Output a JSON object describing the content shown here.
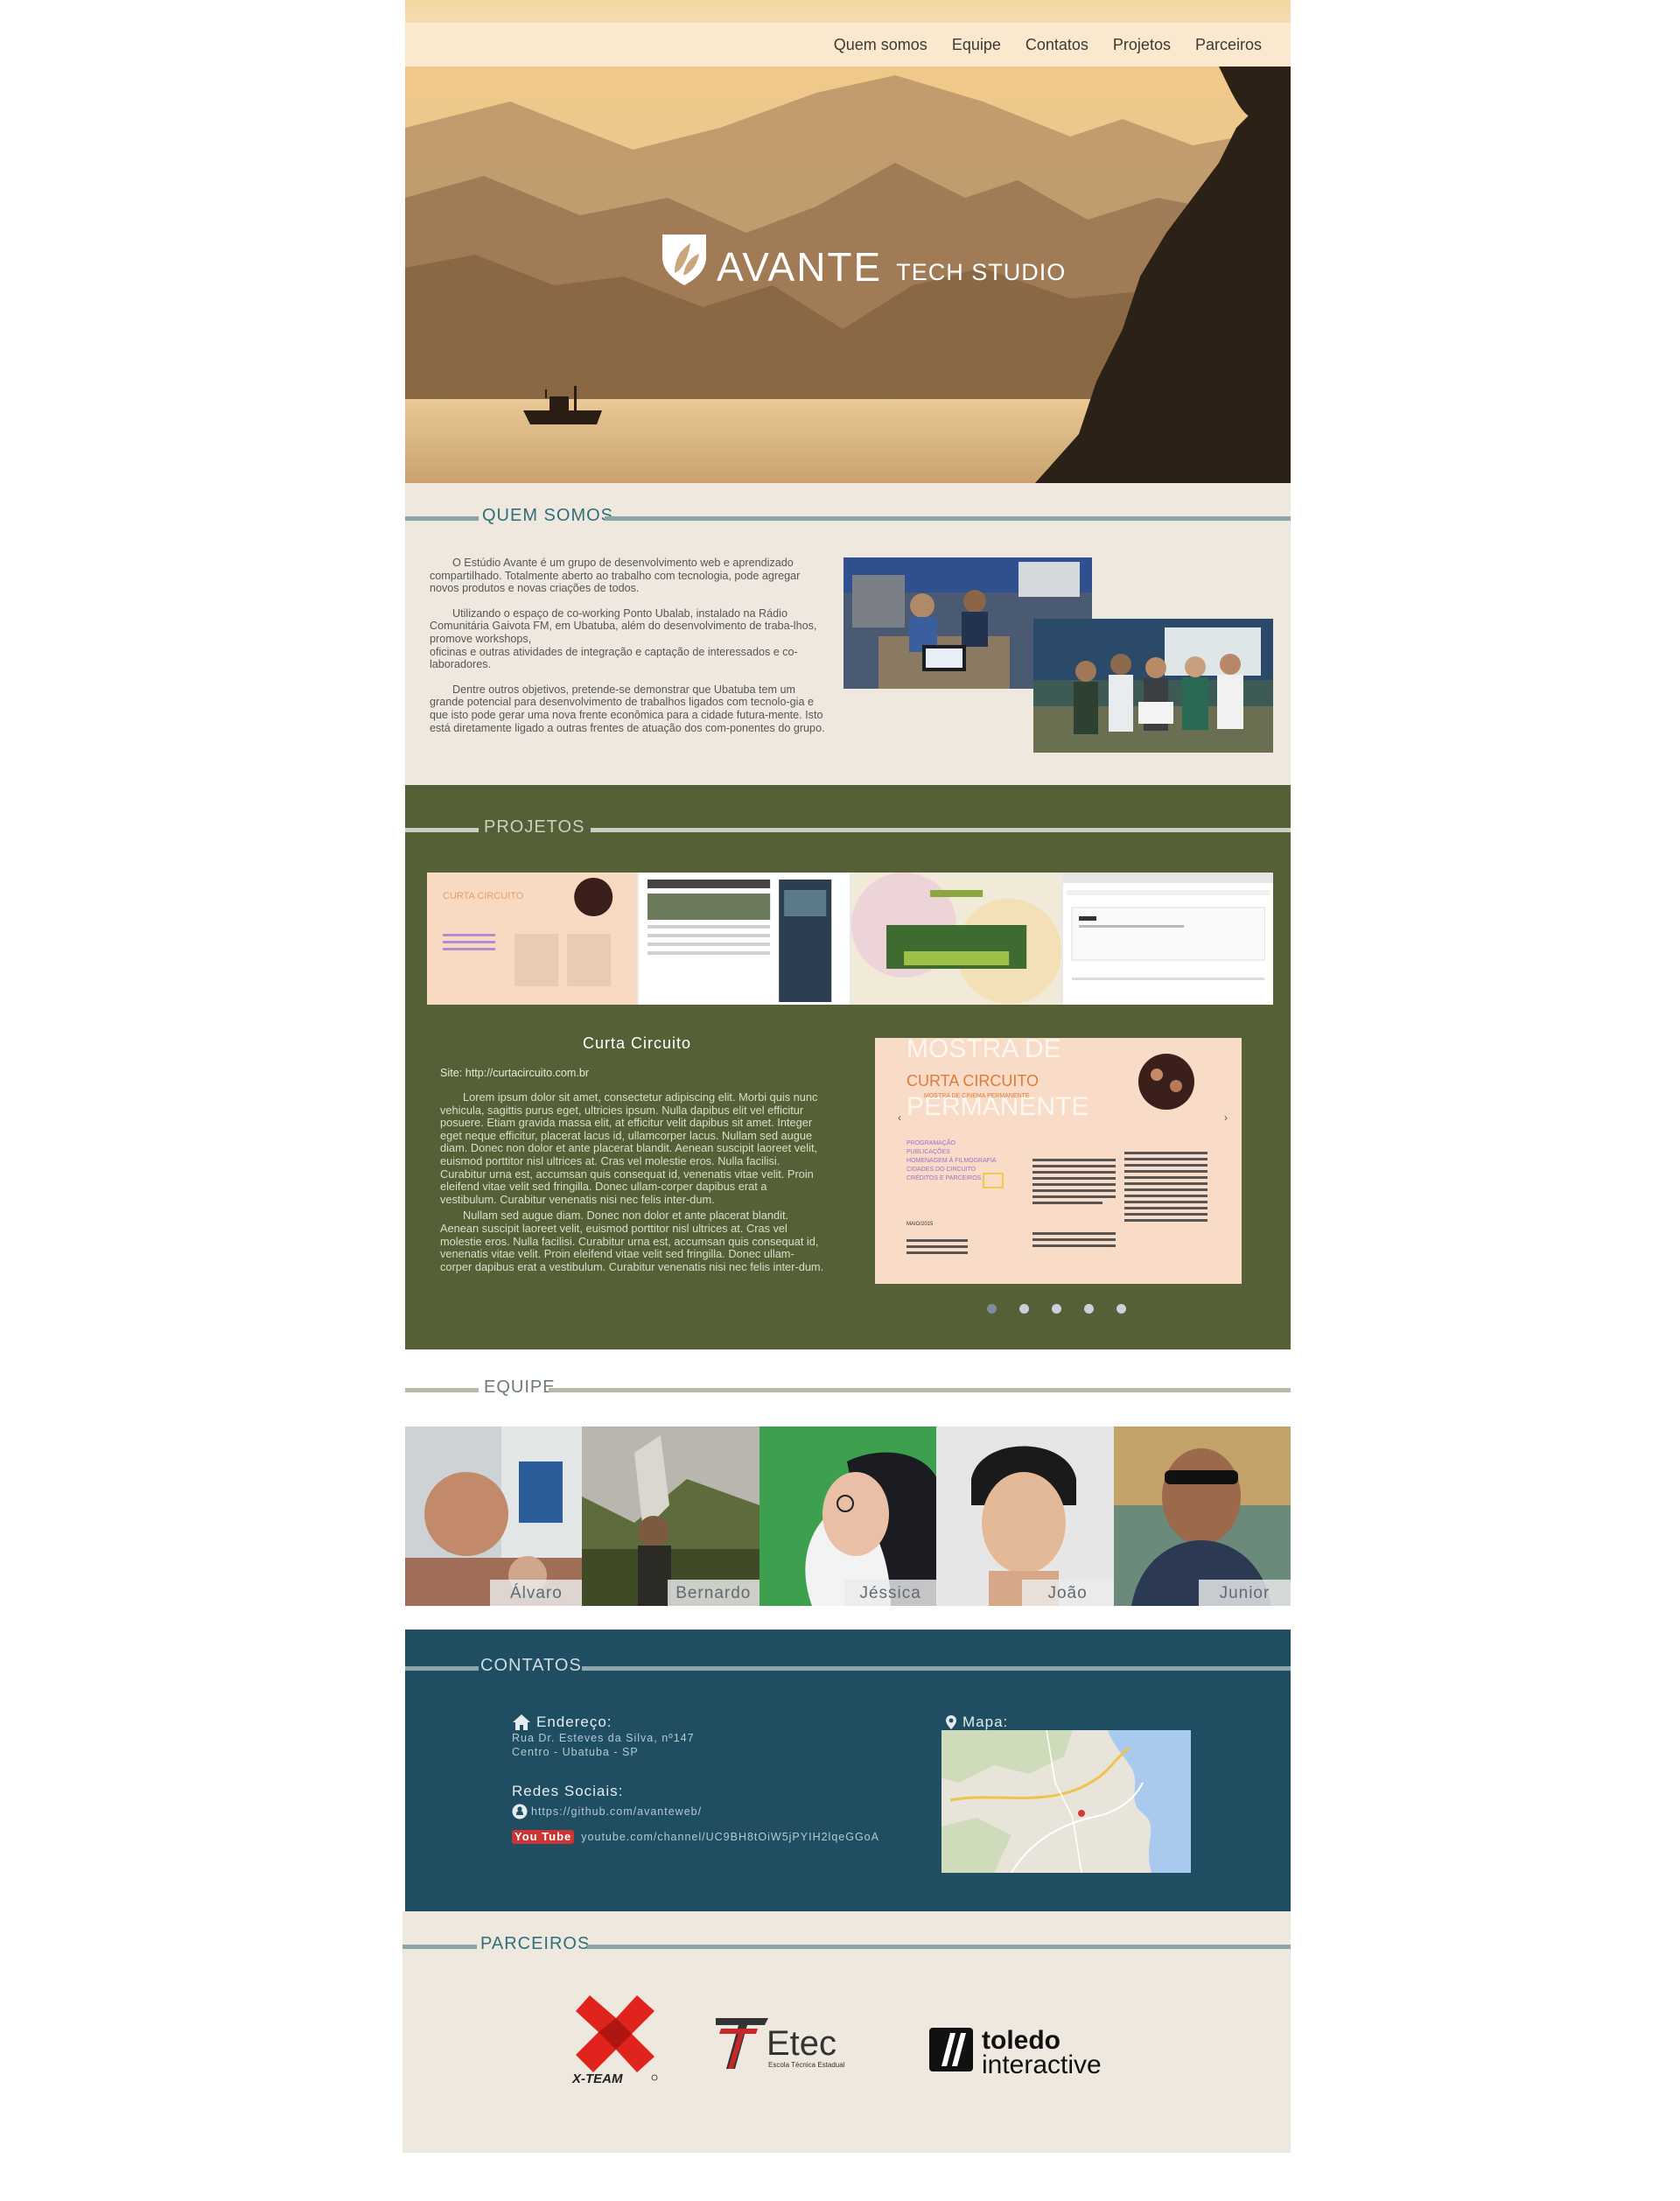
{
  "nav": {
    "items": [
      "Quem somos",
      "Equipe",
      "Contatos",
      "Projetos",
      "Parceiros"
    ]
  },
  "brand": {
    "name": "AVANTE",
    "tagline": "TECH STUDIO"
  },
  "sections": {
    "quem_somos": "QUEM SOMOS",
    "projetos": "PROJETOS",
    "equipe": "EQUIPE",
    "contatos": "CONTATOS",
    "parceiros": "PARCEIROS"
  },
  "about": {
    "paragraphs": [
      "O Estúdio Avante é um grupo de desenvolvimento web e aprendizado compartilhado. Totalmente aberto ao trabalho com tecnologia, pode agregar novos produtos e novas criações de todos.",
      "Utilizando o espaço de co-working Ponto Ubalab, instalado na Rádio Comunitária Gaivota FM, em Ubatuba, além do desenvolvimento de traba-lhos, promove workshops,\noficinas e outras atividades de integração e captação de interessados e co-laboradores.",
      "Dentre outros objetivos, pretende-se demonstrar que Ubatuba tem um grande potencial para desenvolvimento de trabalhos ligados com tecnolo-gia e que isto pode gerar uma nova frente econômica para a cidade futura-mente. Isto está diretamente ligado a outras frentes de atuação dos com-ponentes do grupo."
    ]
  },
  "project": {
    "title": "Curta Circuito",
    "site_label": "Site:",
    "site_url": "http://curtacircuito.com.br",
    "paragraphs": [
      "Lorem ipsum dolor sit amet, consectetur adipiscing elit. Morbi quis nunc vehicula, sagittis purus eget, ultricies ipsum. Nulla dapibus elit vel efficitur posuere. Etiam gravida massa elit, at efficitur velit dapibus sit amet. Integer eget neque efficitur, placerat lacus id, ullamcorper lacus. Nullam sed augue diam. Donec non dolor et ante placerat blandit. Aenean suscipit laoreet velit, euismod porttitor nisl ultrices at. Cras vel molestie eros. Nulla facilisi. Curabitur urna est, accumsan quis consequat id, venenatis vitae velit. Proin eleifend vitae velit sed fringilla. Donec ullam-corper dapibus erat a vestibulum. Curabitur venenatis nisi nec felis inter-dum.",
      "Nullam sed augue diam. Donec non dolor et ante placerat blandit. Aenean suscipit laoreet velit, euismod porttitor nisl ultrices at. Cras vel molestie eros. Nulla facilisi. Curabitur urna est, accumsan quis consequat id, venenatis vitae velit. Proin eleifend vitae velit sed fringilla. Donec ullam-corper dapibus erat a vestibulum. Curabitur venenatis nisi nec felis inter-dum."
    ],
    "preview": {
      "logo": "CURTA CIRCUITO",
      "logo_sub": "MOSTRA DE CINEMA PERMANENTE",
      "bg_text_1": "MOSTRA DE",
      "bg_text_2": "PERMANENTE",
      "menu": [
        "PROGRAMAÇÃO",
        "PUBLICAÇÕES",
        "HOMENAGEM À FILMOGRAFIA",
        "CIDADES DO CIRCUITO",
        "CRÉDITOS E PARCEIROS"
      ],
      "month": "MAIO/2015"
    },
    "slides_total": 5,
    "slide_active": 1
  },
  "team": [
    {
      "name": "Álvaro"
    },
    {
      "name": "Bernardo"
    },
    {
      "name": "Jéssica"
    },
    {
      "name": "João"
    },
    {
      "name": "Junior"
    }
  ],
  "contacts": {
    "address_label": "Endereço:",
    "address_line1": "Rua Dr. Esteves da Silva, nº147",
    "address_line2": "Centro - Ubatuba - SP",
    "social_label": "Redes Sociais:",
    "github": "https://github.com/avanteweb/",
    "youtube_label": "You Tube",
    "youtube": "youtube.com/channel/UC9BH8tOiW5jPYIH2lqeGGoA",
    "map_label": "Mapa:"
  },
  "partners": {
    "xteam": "X-TEAM",
    "etec": "Etec",
    "etec_sub": "Escola Técnica Estadual",
    "toledo_1": "toledo",
    "toledo_2": "interactive"
  },
  "colors": {
    "quem_bg": "#efe8de",
    "projetos_bg": "#556036",
    "contatos_bg": "#1f4d61",
    "heading_teal": "#2f6f7a",
    "heading_line": "#8ba6a4"
  }
}
